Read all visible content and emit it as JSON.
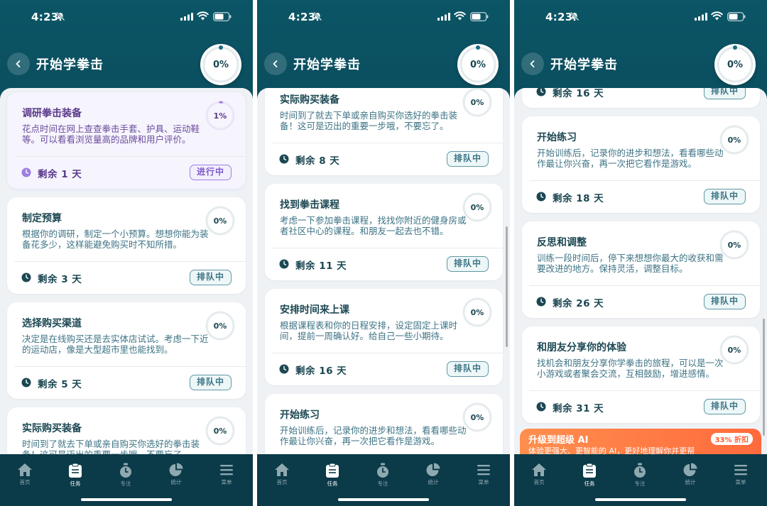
{
  "status_bar": {
    "time": "4:23"
  },
  "header": {
    "title": "开始学拳击",
    "overall_progress": "0%"
  },
  "colors": {
    "background": "#0a4150",
    "accent_active": "#7b58c9",
    "queued": "#3b7484",
    "promo": "#ff6a3c"
  },
  "tasks": [
    {
      "title": "调研拳击装备",
      "desc": "花点时间在网上查查拳击手套、护具、运动鞋等。可以看看浏览量高的品牌和用户评价。",
      "progress": "1%",
      "days_left": "剩余 1 天",
      "status": "进行中"
    },
    {
      "title": "制定预算",
      "desc": "根据你的调研，制定一个小预算。想想你能为装备花多少，这样能避免购买时不知所措。",
      "progress": "0%",
      "days_left": "剩余 3 天",
      "status": "排队中"
    },
    {
      "title": "选择购买渠道",
      "desc": "决定是在线购买还是去实体店试试。考虑一下近的运动店，像是大型超市里也能找到。",
      "progress": "0%",
      "days_left": "剩余 5 天",
      "status": "排队中"
    },
    {
      "title": "实际购买装备",
      "desc": "时间到了就去下单或亲自购买你选好的拳击装备！这可是迈出的重要一步哦，不要忘了。",
      "progress": "0%",
      "days_left": "剩余 8 天",
      "status": "排队中"
    },
    {
      "title": "找到拳击课程",
      "desc": "考虑一下参加拳击课程，找找你附近的健身房或者社区中心的课程。和朋友一起去也不错。",
      "progress": "0%",
      "days_left": "剩余 11 天",
      "status": "排队中"
    },
    {
      "title": "安排时间来上课",
      "desc": "根据课程表和你的日程安排，设定固定上课时间，提前一周确认好。给自己一些小期待。",
      "progress": "0%",
      "days_left": "剩余 16 天",
      "status": "排队中"
    },
    {
      "title": "开始练习",
      "desc": "开始训练后，记录你的进步和想法，看看哪些动作最让你兴奋，再一次把它看作是游戏。",
      "progress": "0%",
      "days_left": "剩余 18 天",
      "status": "排队中"
    },
    {
      "title": "反思和调整",
      "desc": "训练一段时间后，停下来想想你最大的收获和需要改进的地方。保持灵活，调整目标。",
      "progress": "0%",
      "days_left": "剩余 26 天",
      "status": "排队中"
    },
    {
      "title": "和朋友分享你的体验",
      "desc": "找机会和朋友分享你学拳击的旅程，可以是一次小游戏或者聚会交流，互相鼓励，增进感情。",
      "progress": "0%",
      "days_left": "剩余 31 天",
      "status": "排队中"
    }
  ],
  "promo": {
    "title": "升级到超级 AI",
    "subtitle": "体验更强大、更智能的 AI，更好地理解你并更帮",
    "badge": "33% 折扣"
  },
  "tabs": [
    {
      "label": "首页",
      "icon": "home-icon"
    },
    {
      "label": "任务",
      "icon": "task-list-icon"
    },
    {
      "label": "专注",
      "icon": "stopwatch-icon"
    },
    {
      "label": "统计",
      "icon": "pie-chart-icon"
    },
    {
      "label": "菜单",
      "icon": "menu-icon"
    }
  ]
}
